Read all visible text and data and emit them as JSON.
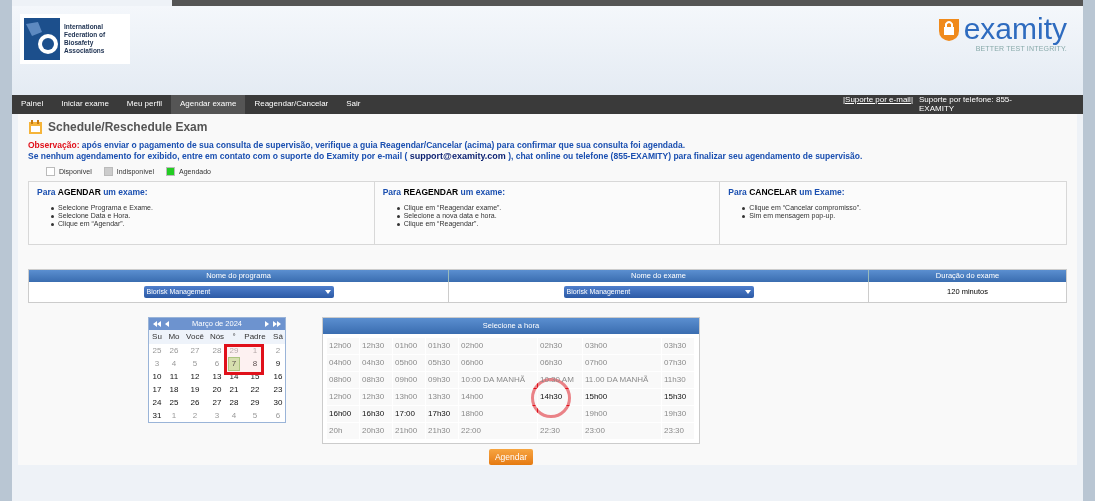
{
  "header": {
    "org_name": "International Federation of Biosafety Associations",
    "brand": "examity",
    "tagline": "BETTER TEST INTEGRITY."
  },
  "nav": {
    "items": [
      {
        "label": "Painel",
        "selected": false
      },
      {
        "label": "Iniciar exame",
        "selected": false
      },
      {
        "label": "Meu perfil",
        "selected": false
      },
      {
        "label": "Agendar exame",
        "selected": true
      },
      {
        "label": "Reagendar/Cancelar",
        "selected": false
      },
      {
        "label": "Sair",
        "selected": false
      }
    ],
    "support_email": "|Suporte por e-mail|",
    "support_phone": "Suporte por telefone: 855-EXAMITY"
  },
  "page_title": "Schedule/Reschedule Exam",
  "note": {
    "label": "Observação:",
    "text": "após enviar o pagamento de sua consulta de supervisão, verifique a guia Reagendar/Cancelar (acima) para confirmar que sua consulta foi agendada.",
    "line2_before": "Se nenhum agendamento for exibido, entre em contato com o suporte do Examity por e-mail (",
    "email": "support@examity.com",
    "line2_after": "), chat online ou telefone (855-EXAMITY) para finalizar seu agendamento de supervisão."
  },
  "legend": [
    {
      "label": "Disponível",
      "color": "#ffffff"
    },
    {
      "label": "Indisponível",
      "color": "#cccccc"
    },
    {
      "label": "Agendado",
      "color": "#22cc22"
    }
  ],
  "instructions": [
    {
      "title": "Para **AGENDAR** um exame:",
      "steps": [
        "Selecione Programa e Exame.",
        "Selecione Data e Hora.",
        "Clique em “Agendar”."
      ]
    },
    {
      "title": "Para **REAGENDAR** um exame:",
      "steps": [
        "Clique em “Reagendar exame”.",
        "Selecione a nova data e hora.",
        "Clique em “Reagendar”."
      ]
    },
    {
      "title": "Para **CANCELAR** um Exame:",
      "steps": [
        "Clique em “Cancelar compromisso”.",
        "Sim em mensagem pop-up."
      ]
    }
  ],
  "table": {
    "columns": [
      "Nome do programa",
      "Nome do exame",
      "Duração do exame"
    ],
    "row": {
      "program": "Biorisk Management",
      "exam": "Biorisk Management",
      "duration": "120 minutos"
    }
  },
  "calendar": {
    "month": "Março de 2024",
    "weekdays": [
      "Su",
      "Mo",
      "Você",
      "Nós",
      "°",
      "Padre",
      "Sá"
    ],
    "weeks": [
      [
        {
          "day": "25",
          "muted": true,
          "selected": false
        },
        {
          "day": "26",
          "muted": true,
          "selected": false
        },
        {
          "day": "27",
          "muted": true,
          "selected": false
        },
        {
          "day": "28",
          "muted": true,
          "selected": false
        },
        {
          "day": "29",
          "muted": true,
          "selected": false
        },
        {
          "day": "1",
          "muted": true,
          "selected": false
        },
        {
          "day": "2",
          "muted": true,
          "selected": false
        }
      ],
      [
        {
          "day": "3",
          "muted": true,
          "selected": false
        },
        {
          "day": "4",
          "muted": true,
          "selected": false
        },
        {
          "day": "5",
          "muted": true,
          "selected": false
        },
        {
          "day": "6",
          "muted": true,
          "selected": false
        },
        {
          "day": "7",
          "muted": false,
          "selected": true
        },
        {
          "day": "8",
          "muted": false,
          "selected": false
        },
        {
          "day": "9",
          "muted": false,
          "selected": false
        }
      ],
      [
        {
          "day": "10",
          "muted": false,
          "selected": false
        },
        {
          "day": "11",
          "muted": false,
          "selected": false
        },
        {
          "day": "12",
          "muted": false,
          "selected": false
        },
        {
          "day": "13",
          "muted": false,
          "selected": false
        },
        {
          "day": "14",
          "muted": false,
          "selected": false
        },
        {
          "day": "15",
          "muted": false,
          "selected": false
        },
        {
          "day": "16",
          "muted": false,
          "selected": false
        }
      ],
      [
        {
          "day": "17",
          "muted": false,
          "selected": false
        },
        {
          "day": "18",
          "muted": false,
          "selected": false
        },
        {
          "day": "19",
          "muted": false,
          "selected": false
        },
        {
          "day": "20",
          "muted": false,
          "selected": false
        },
        {
          "day": "21",
          "muted": false,
          "selected": false
        },
        {
          "day": "22",
          "muted": false,
          "selected": false
        },
        {
          "day": "23",
          "muted": false,
          "selected": false
        }
      ],
      [
        {
          "day": "24",
          "muted": false,
          "selected": false
        },
        {
          "day": "25",
          "muted": false,
          "selected": false
        },
        {
          "day": "26",
          "muted": false,
          "selected": false
        },
        {
          "day": "27",
          "muted": false,
          "selected": false
        },
        {
          "day": "28",
          "muted": false,
          "selected": false
        },
        {
          "day": "29",
          "muted": false,
          "selected": false
        },
        {
          "day": "30",
          "muted": false,
          "selected": false
        }
      ],
      [
        {
          "day": "31",
          "muted": false,
          "selected": false
        },
        {
          "day": "1",
          "muted": true,
          "selected": false
        },
        {
          "day": "2",
          "muted": true,
          "selected": false
        },
        {
          "day": "3",
          "muted": true,
          "selected": false
        },
        {
          "day": "4",
          "muted": true,
          "selected": false
        },
        {
          "day": "5",
          "muted": true,
          "selected": false
        },
        {
          "day": "6",
          "muted": true,
          "selected": false
        }
      ]
    ]
  },
  "time_picker": {
    "title": "Selecione a hora",
    "rows": [
      [
        {
          "label": "12h00",
          "available": false
        },
        {
          "label": "12h30",
          "available": false
        },
        {
          "label": "01h00",
          "available": false
        },
        {
          "label": "01h30",
          "available": false
        },
        {
          "label": "02h00",
          "available": false
        },
        {
          "label": "02h30",
          "available": false
        },
        {
          "label": "03h00",
          "available": false
        },
        {
          "label": "03h30",
          "available": false
        }
      ],
      [
        {
          "label": "04h00",
          "available": false
        },
        {
          "label": "04h30",
          "available": false
        },
        {
          "label": "05h00",
          "available": false
        },
        {
          "label": "05h30",
          "available": false
        },
        {
          "label": "06h00",
          "available": false
        },
        {
          "label": "06h30",
          "available": false
        },
        {
          "label": "07h00",
          "available": false
        },
        {
          "label": "07h30",
          "available": false
        }
      ],
      [
        {
          "label": "08h00",
          "available": false
        },
        {
          "label": "08h30",
          "available": false
        },
        {
          "label": "09h00",
          "available": false
        },
        {
          "label": "09h30",
          "available": false
        },
        {
          "label": "10:00 DA MANHÃ",
          "available": false
        },
        {
          "label": "10:30 AM",
          "available": false
        },
        {
          "label": "11.00 DA MANHÃ",
          "available": false
        },
        {
          "label": "11h30",
          "available": false
        }
      ],
      [
        {
          "label": "12h00",
          "available": false
        },
        {
          "label": "12h30",
          "available": false
        },
        {
          "label": "13h00",
          "available": false
        },
        {
          "label": "13h30",
          "available": false
        },
        {
          "label": "14h00",
          "available": false
        },
        {
          "label": "14h30",
          "available": true
        },
        {
          "label": "15h00",
          "available": true
        },
        {
          "label": "15h30",
          "available": true
        }
      ],
      [
        {
          "label": "16h00",
          "available": true
        },
        {
          "label": "16h30",
          "available": true
        },
        {
          "label": "17:00",
          "available": true
        },
        {
          "label": "17h30",
          "available": true
        },
        {
          "label": "18h00",
          "available": false
        },
        {},
        {
          "label": "19h00",
          "available": false
        },
        {
          "label": "19h30",
          "available": false
        }
      ],
      [
        {
          "label": "20h",
          "available": false
        },
        {
          "label": "20h30",
          "available": false
        },
        {
          "label": "21h00",
          "available": false
        },
        {
          "label": "21h30",
          "available": false
        },
        {
          "label": "22:00",
          "available": false
        },
        {
          "label": "22:30",
          "available": false
        },
        {
          "label": "23:00",
          "available": false
        },
        {
          "label": "23:30",
          "available": false
        }
      ]
    ]
  },
  "submit": "Agendar"
}
